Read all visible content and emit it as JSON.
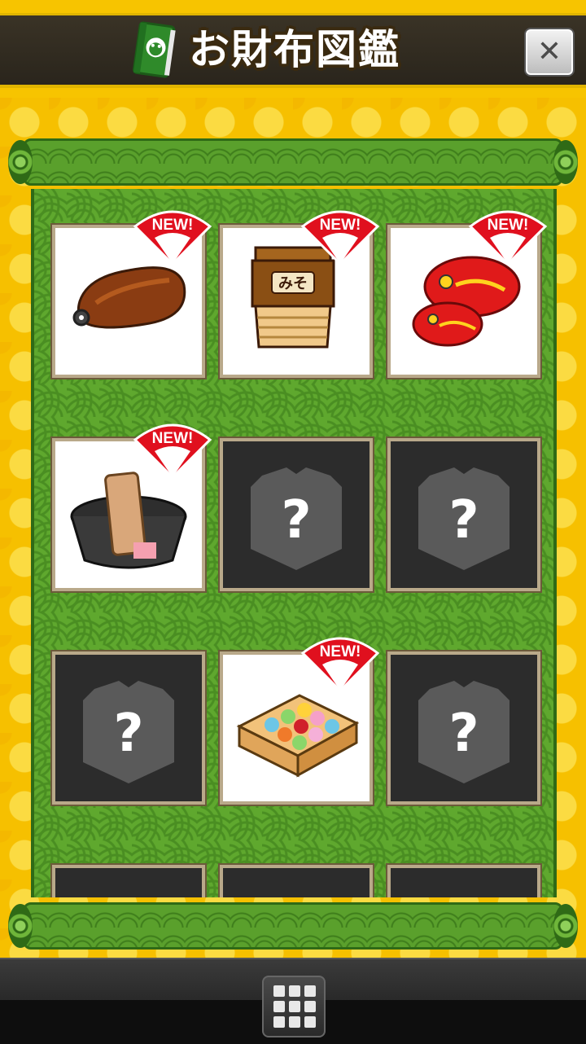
{
  "header": {
    "title": "お財布図鑑",
    "book_icon": "green-book-icon",
    "close_label": "✕"
  },
  "grid": {
    "cells": [
      {
        "state": "found",
        "icon": "grilled-eel-icon",
        "new": true
      },
      {
        "state": "found",
        "icon": "miso-barrel-icon",
        "new": true
      },
      {
        "state": "found",
        "icon": "red-sea-bream-icon",
        "new": true
      },
      {
        "state": "found",
        "icon": "washboard-tub-icon",
        "new": true
      },
      {
        "state": "locked",
        "icon": "mystery-bag-icon",
        "new": false
      },
      {
        "state": "locked",
        "icon": "mystery-bag-icon",
        "new": false
      },
      {
        "state": "locked",
        "icon": "mystery-bag-icon",
        "new": false
      },
      {
        "state": "found",
        "icon": "wagashi-box-icon",
        "new": true
      },
      {
        "state": "locked",
        "icon": "mystery-bag-icon",
        "new": false
      }
    ],
    "new_label": "NEW!",
    "unknown_label": "?"
  },
  "bottom_nav": {
    "menu_icon": "grid-menu-icon"
  },
  "colors": {
    "background_yellow": "#f6c000",
    "scroll_green": "#5fa82e",
    "badge_red": "#e0101e",
    "locked_cell": "#2c2c2c"
  }
}
